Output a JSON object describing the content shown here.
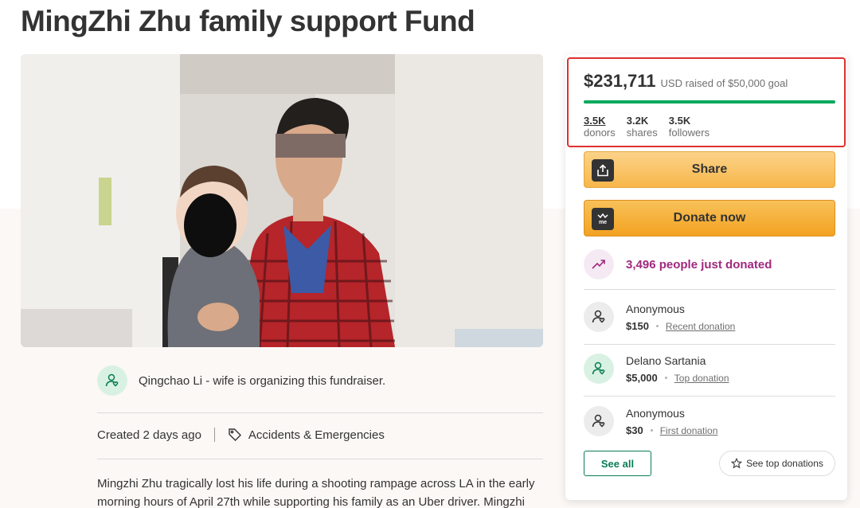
{
  "page_title": "MingZhi Zhu family support Fund",
  "organizer": {
    "text": "Qingchao Li - wife is organizing this fundraiser."
  },
  "meta": {
    "created": "Created 2 days ago",
    "category": "Accidents & Emergencies"
  },
  "story": "Mingzhi Zhu tragically lost his life during a shooting rampage across LA in the early morning hours of April 27th while supporting his family as an Uber driver. Mingzhi was",
  "progress": {
    "amount": "$231,711",
    "goal_text": "USD raised of $50,000 goal",
    "fraction": 1.0,
    "bar_color": "#02a95c"
  },
  "stats": [
    {
      "value": "3.5K",
      "label": "donors"
    },
    {
      "value": "3.2K",
      "label": "shares"
    },
    {
      "value": "3.5K",
      "label": "followers"
    }
  ],
  "buttons": {
    "share": "Share",
    "donate": "Donate now",
    "see_all": "See all",
    "see_top": "See top donations"
  },
  "donate_icon_text": "me",
  "trend_text": "3,496 people just donated",
  "donations": [
    {
      "name": "Anonymous",
      "amount": "$150",
      "kind": "Recent donation"
    },
    {
      "name": "Delano Sartania",
      "amount": "$5,000",
      "kind": "Top donation"
    },
    {
      "name": "Anonymous",
      "amount": "$30",
      "kind": "First donation"
    }
  ],
  "colors": {
    "accent_green": "#02a95c",
    "trend_purple": "#a0287e",
    "highlight_red": "#e0302f"
  }
}
